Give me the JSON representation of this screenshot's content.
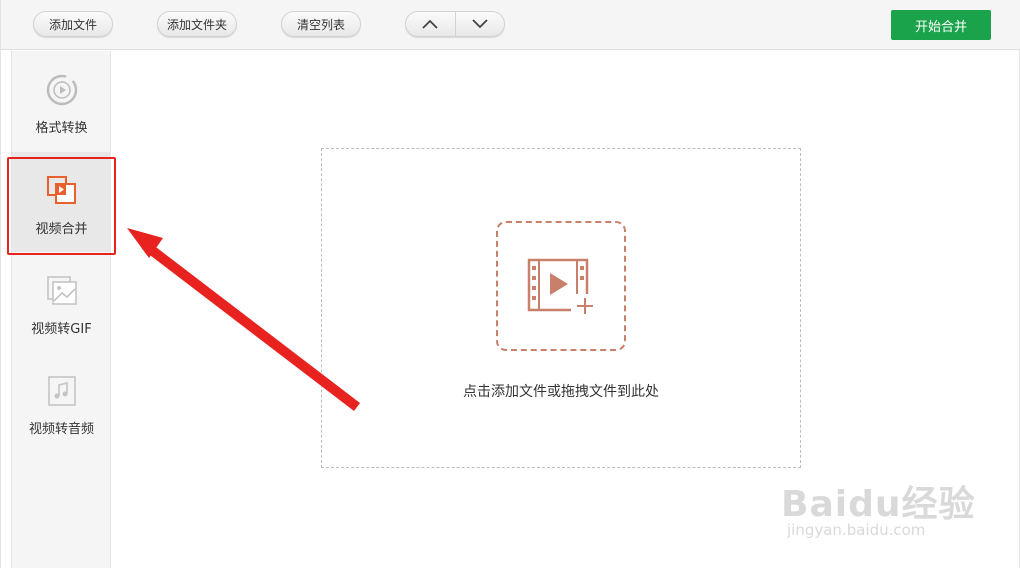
{
  "toolbar": {
    "add_file": "添加文件",
    "add_folder": "添加文件夹",
    "clear_list": "清空列表",
    "start_merge": "开始合并"
  },
  "sidebar": {
    "items": [
      {
        "label": "格式转换",
        "icon": "play-circle-icon"
      },
      {
        "label": "视频合并",
        "icon": "video-merge-icon",
        "active": true
      },
      {
        "label": "视频转GIF",
        "icon": "image-icon"
      },
      {
        "label": "视频转音频",
        "icon": "music-note-icon"
      }
    ]
  },
  "main": {
    "drop_text": "点击添加文件或拖拽文件到此处"
  },
  "watermark": {
    "logo": "Baidu经验",
    "url": "jingyan.baidu.com"
  },
  "colors": {
    "accent_green": "#1aa34a",
    "merge_orange": "#e8602c",
    "annotation_red": "#e8231f",
    "drop_icon": "#c9806a"
  }
}
